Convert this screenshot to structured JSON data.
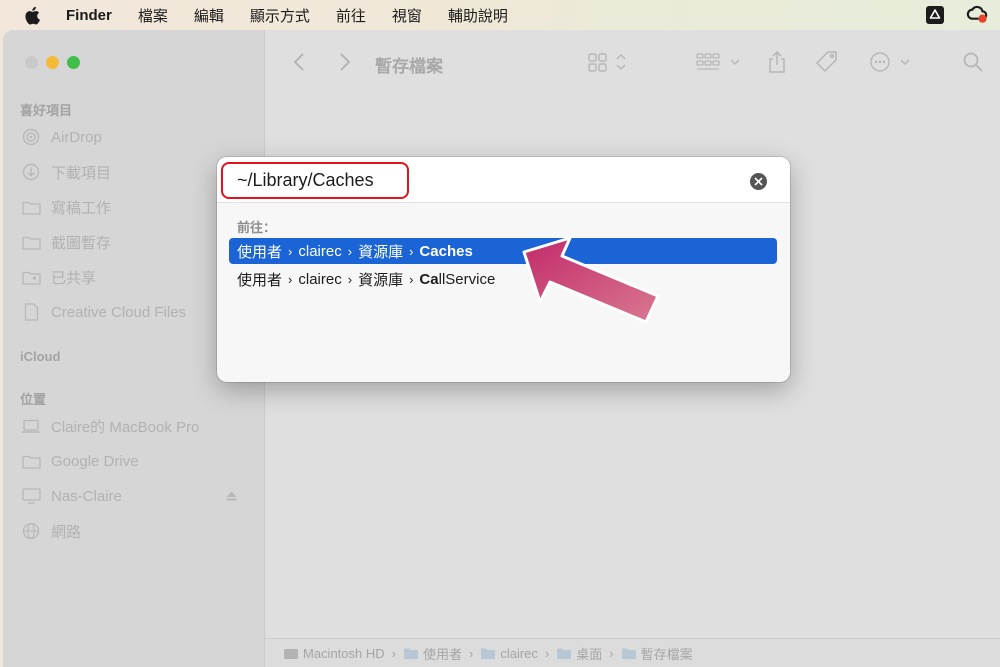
{
  "menubar": {
    "app_name": "Finder",
    "items": [
      "檔案",
      "編輯",
      "顯示方式",
      "前往",
      "視窗",
      "輔助說明"
    ]
  },
  "window": {
    "title": "暫存檔案",
    "sidebar": {
      "favorites_title": "喜好項目",
      "favorites": [
        {
          "label": "AirDrop",
          "icon": "airdrop-icon"
        },
        {
          "label": "下載項目",
          "icon": "download-icon"
        },
        {
          "label": "寫稿工作",
          "icon": "folder-icon"
        },
        {
          "label": "截圖暫存",
          "icon": "folder-icon"
        },
        {
          "label": "已共享",
          "icon": "shared-folder-icon"
        },
        {
          "label": "Creative Cloud Files",
          "icon": "document-icon"
        }
      ],
      "icloud_title": "iCloud",
      "locations_title": "位置",
      "locations": [
        {
          "label": "Claire的 MacBook Pro",
          "icon": "laptop-icon"
        },
        {
          "label": "Google Drive",
          "icon": "drive-icon"
        },
        {
          "label": "Nas-Claire",
          "icon": "display-icon"
        },
        {
          "label": "網路",
          "icon": "network-icon"
        }
      ]
    },
    "pathbar": [
      {
        "label": "Macintosh HD",
        "icon": "hard-drive-icon"
      },
      {
        "label": "使用者",
        "icon": "folder-icon"
      },
      {
        "label": "clairec",
        "icon": "home-folder-icon"
      },
      {
        "label": "桌面",
        "icon": "folder-icon"
      },
      {
        "label": "暫存檔案",
        "icon": "folder-icon"
      }
    ]
  },
  "dialog": {
    "path_value": "~/Library/Caches",
    "goto_label": "前往：",
    "results": [
      {
        "parts": [
          "使用者",
          "clairec",
          "資源庫"
        ],
        "bold": "Caches",
        "rest": "",
        "selected": true
      },
      {
        "parts": [
          "使用者",
          "clairec",
          "資源庫"
        ],
        "bold": "Ca",
        "rest": "llService",
        "selected": false
      }
    ]
  },
  "colors": {
    "selection": "#1a64d6",
    "highlight_box": "#e3131d",
    "arrow": "#c8336c"
  }
}
